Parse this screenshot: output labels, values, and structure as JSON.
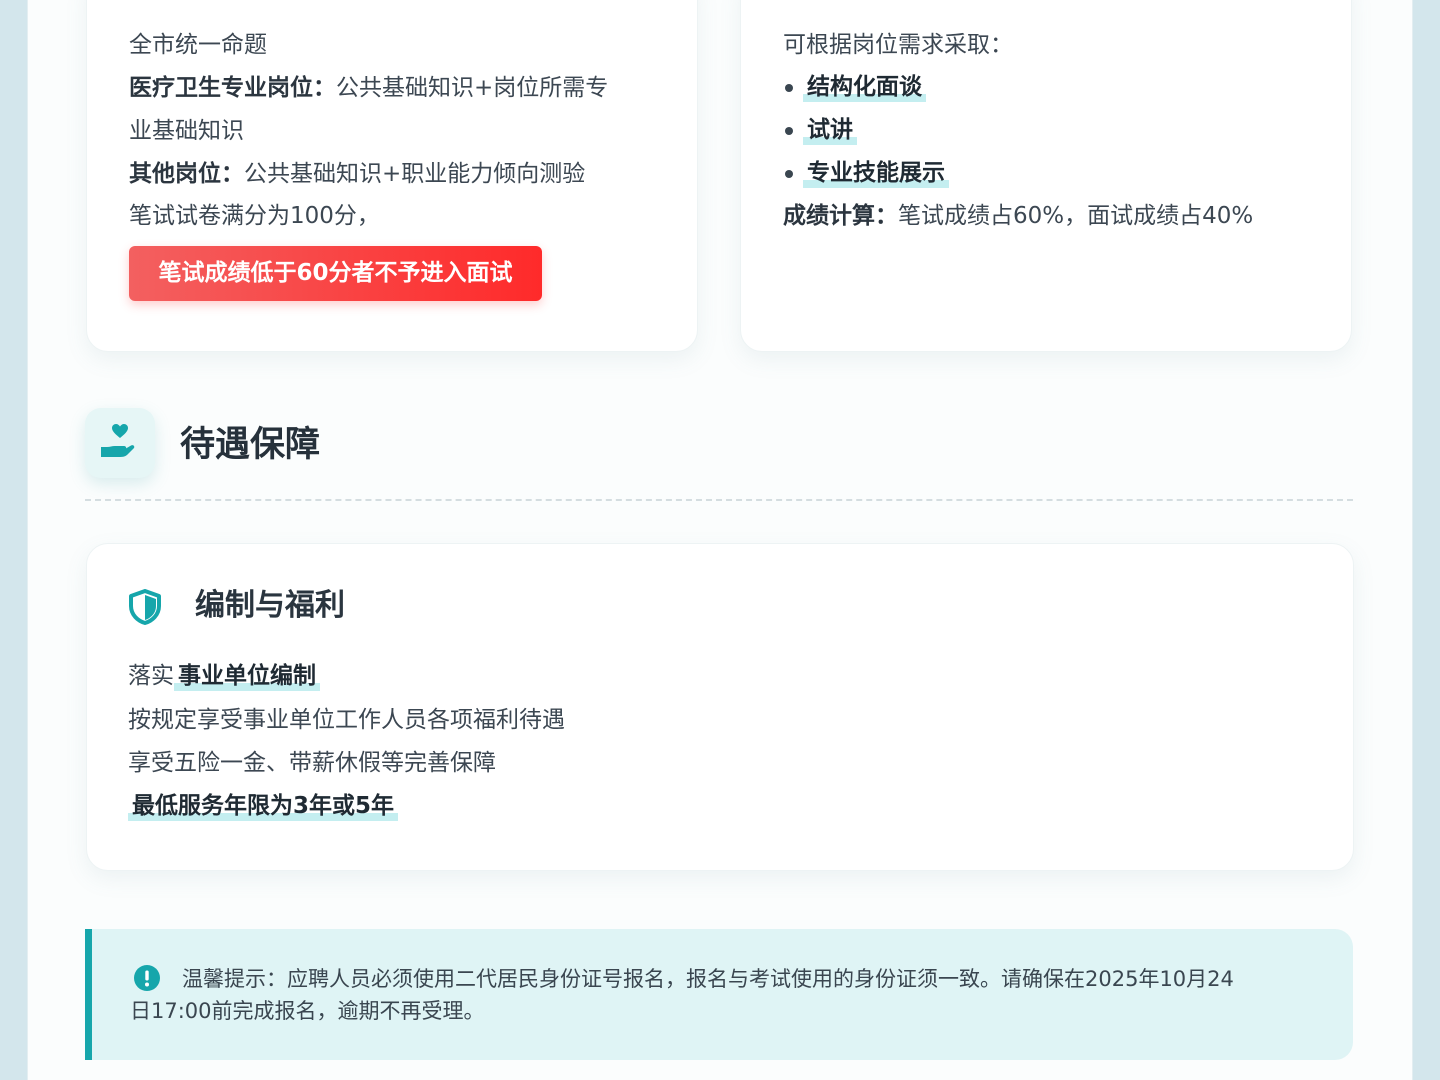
{
  "exam": {
    "left": {
      "line1": "全市统一命题",
      "medical_label": "医疗卫生专业岗位：",
      "medical_text_a": "公共基础知识+岗位所需专",
      "medical_text_b": "业基础知识",
      "other_label": "其他岗位：",
      "other_text": "公共基础知识+职业能力倾向测验",
      "score_line": "笔试试卷满分为100分，",
      "warning": "笔试成绩低于60分者不予进入面试"
    },
    "right": {
      "intro": "可根据岗位需求采取：",
      "methods": [
        "结构化面谈",
        "试讲",
        "专业技能展示"
      ],
      "calc_label": "成绩计算：",
      "calc_text": "笔试成绩占60%，面试成绩占40%"
    }
  },
  "section": {
    "title": "待遇保障",
    "icon": "hand-heart-icon"
  },
  "benefit": {
    "title": "编制与福利",
    "icon": "shield-icon",
    "line1_prefix": "落实",
    "line1_highlight": "事业单位编制",
    "line2": "按规定享受事业单位工作人员各项福利待遇",
    "line3": "享受五险一金、带薪休假等完善保障",
    "line4_highlight": "最低服务年限为3年或5年"
  },
  "notice": {
    "icon": "info-exclamation-icon",
    "text_line1": "温馨提示：应聘人员必须使用二代居民身份证号报名，报名与考试使用的身份证须一致。请确保在2025年10月24",
    "text_line2": "日17:00前完成报名，逾期不再受理。"
  },
  "colors": {
    "accent": "#16a6ab",
    "highlight": "#c4eef0",
    "warning_start": "#f36060",
    "warning_end": "#ff2a2a",
    "notice_bg": "#dff4f5"
  }
}
